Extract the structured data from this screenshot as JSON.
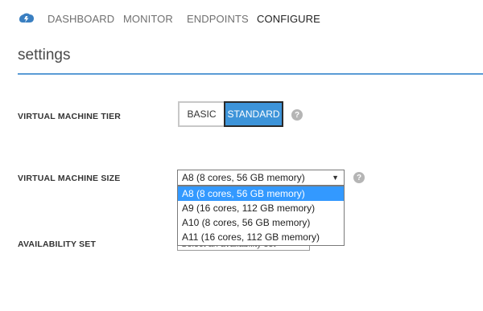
{
  "nav": {
    "logo_icon": "azure-cloud-icon",
    "tabs": [
      {
        "label": "DASHBOARD"
      },
      {
        "label": "MONITOR"
      },
      {
        "label": "ENDPOINTS"
      },
      {
        "label": "CONFIGURE",
        "active": true
      }
    ]
  },
  "page": {
    "title": "settings"
  },
  "tier": {
    "label": "VIRTUAL MACHINE TIER",
    "options": [
      "BASIC",
      "STANDARD"
    ],
    "selected": "STANDARD",
    "help_icon": "?"
  },
  "size": {
    "label": "VIRTUAL MACHINE SIZE",
    "value": "A8 (8 cores, 56 GB memory)",
    "arrow_icon": "▼",
    "help_icon": "?",
    "options": [
      "A8 (8 cores, 56 GB memory)",
      "A9 (16 cores, 112 GB memory)",
      "A10 (8 cores, 56 GB memory)",
      "A11 (16 cores, 112 GB memory)"
    ],
    "highlighted_index": 0
  },
  "availability": {
    "label": "AVAILABILITY SET",
    "placeholder": "Select an availability set"
  },
  "colors": {
    "accent": "#3d94d9",
    "title_rule": "#5a9bd5",
    "dropdown_highlight": "#3399ff"
  }
}
